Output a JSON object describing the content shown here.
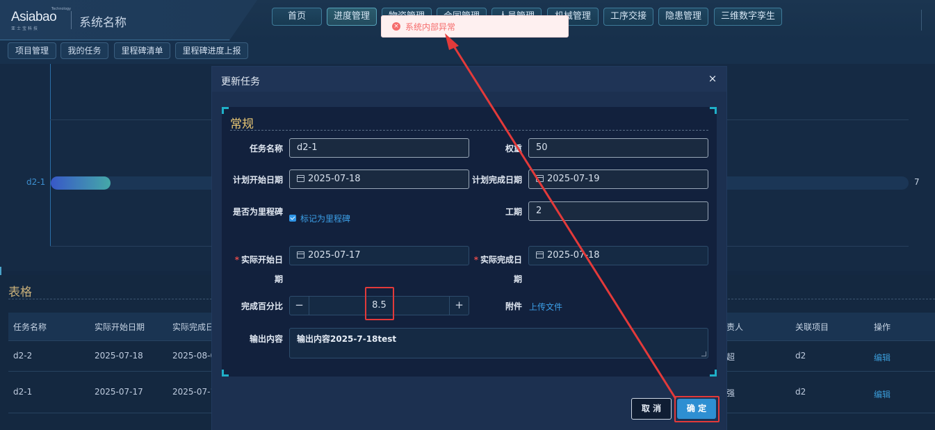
{
  "header": {
    "logo_text": "Asiabao",
    "logo_tech": "Technology",
    "logo_cn": "亚士宝科技",
    "system_name": "系统名称",
    "nav": [
      {
        "label": "首页"
      },
      {
        "label": "进度管理"
      },
      {
        "label": "物资管理"
      },
      {
        "label": "合同管理"
      },
      {
        "label": "人员管理"
      },
      {
        "label": "机械管理"
      },
      {
        "label": "工序交接"
      },
      {
        "label": "隐患管理"
      },
      {
        "label": "三维数字孪生"
      }
    ]
  },
  "subnav": [
    {
      "label": "项目管理"
    },
    {
      "label": "我的任务"
    },
    {
      "label": "里程碑清单"
    },
    {
      "label": "里程碑进度上报"
    }
  ],
  "gantt": {
    "row_label": "d2-1",
    "end_value": "7",
    "progress": 0.07
  },
  "table": {
    "title": "表格",
    "headers": [
      "任务名称",
      "实际开始日期",
      "实际完成日",
      "责人",
      "关联项目",
      "操作"
    ],
    "rows": [
      {
        "name": "d2-2",
        "start": "2025-07-18",
        "end": "2025-08-0",
        "owner": "超",
        "project": "d2",
        "action": "编辑"
      },
      {
        "name": "d2-1",
        "start": "2025-07-17",
        "end": "2025-07-1",
        "owner": "强",
        "project": "d2",
        "action": "编辑"
      }
    ]
  },
  "dialog": {
    "title": "更新任务",
    "close": "×",
    "section": "常规",
    "fields": {
      "task_name": {
        "label": "任务名称",
        "value": "d2-1"
      },
      "weight": {
        "label": "权重",
        "value": "50"
      },
      "plan_start": {
        "label": "计划开始日期",
        "value": "2025-07-18"
      },
      "plan_end": {
        "label": "计划完成日期",
        "value": "2025-07-19"
      },
      "milestone": {
        "label": "是否为里程碑",
        "checkbox_label": "标记为里程碑",
        "checked": true
      },
      "duration": {
        "label": "工期",
        "value": "2"
      },
      "actual_start": {
        "label_line1": "实际开始日",
        "label_line2": "期",
        "value": "2025-07-17"
      },
      "actual_end": {
        "label_line1": "实际完成日",
        "label_line2": "期",
        "value": "2025-07-18"
      },
      "percent": {
        "label": "完成百分比",
        "value": "8.5",
        "minus": "−",
        "plus": "+"
      },
      "attachment": {
        "label": "附件",
        "upload": "上传文件"
      },
      "output": {
        "label": "输出内容",
        "value": "输出内容2025-7-18test"
      }
    },
    "cancel": "取 消",
    "confirm": "确 定"
  },
  "toast": {
    "icon": "×",
    "message": "系统内部异常",
    "type": "error"
  },
  "colors": {
    "accent": "#2e8fd2",
    "error": "#f56c6c",
    "section_title": "#e9c774",
    "annotation": "#e33a3a"
  }
}
